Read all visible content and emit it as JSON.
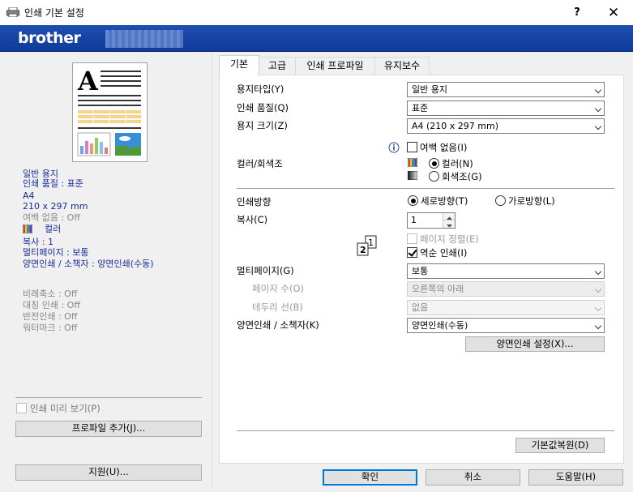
{
  "window": {
    "title": "인쇄 기본 설정",
    "help": "?",
    "close": "✕"
  },
  "brand": {
    "logo": "brother"
  },
  "left": {
    "info": [
      "일반 용지",
      "인쇄 품질 : 표준",
      "A4",
      "210 x 297 mm"
    ],
    "borderless": "여백 없음 : Off",
    "color": "컬러",
    "info2": [
      "복사 : 1",
      "멀티페이지 : 보통",
      "양면인쇄 / 소책자 : 양면인쇄(수동)"
    ],
    "gray_info": [
      "비례축소 : Off",
      "대칭 인쇄 : Off",
      "반전인쇄 : Off",
      "워터마크 : Off"
    ],
    "print_preview": "인쇄 미리 보기(P)",
    "add_profile": "프로파일 추가(J)...",
    "support": "지원(U)..."
  },
  "tabs": [
    "기본",
    "고급",
    "인쇄 프로파일",
    "유지보수"
  ],
  "basic": {
    "paper_type": {
      "label": "용지타입(Y)",
      "value": "일반 용지"
    },
    "print_quality": {
      "label": "인쇄 품질(Q)",
      "value": "표준"
    },
    "paper_size": {
      "label": "용지 크기(Z)",
      "value": "A4 (210 x 297 mm)"
    },
    "borderless": "여백 없음(I)",
    "color_mode": {
      "label": "컬러/회색조",
      "color": "컬러(N)",
      "gray": "회색조(G)"
    },
    "orientation": {
      "label": "인쇄방향",
      "portrait": "세로방향(T)",
      "landscape": "가로방향(L)"
    },
    "copies": {
      "label": "복사(C)",
      "value": "1"
    },
    "collate": "페이지 정렬(E)",
    "reverse": "역순 인쇄(I)",
    "multipage": {
      "label": "멀티페이지(G)",
      "value": "보통"
    },
    "page_order": {
      "label": "페이지 수(O)",
      "value": "오른쪽의 아래"
    },
    "border_line": {
      "label": "테두리 선(B)",
      "value": "없음"
    },
    "duplex": {
      "label": "양면인쇄 / 소책자(K)",
      "value": "양면인쇄(수동)"
    },
    "duplex_settings": "양면인쇄 설정(X)...",
    "defaults": "기본값복원(D)"
  },
  "footer": {
    "ok": "확인",
    "cancel": "취소",
    "help": "도움말(H)"
  },
  "colors": {
    "brand_blue": "#1e4fb0",
    "focus_blue": "#0078d7",
    "info_blue": "#1a2a9c"
  }
}
